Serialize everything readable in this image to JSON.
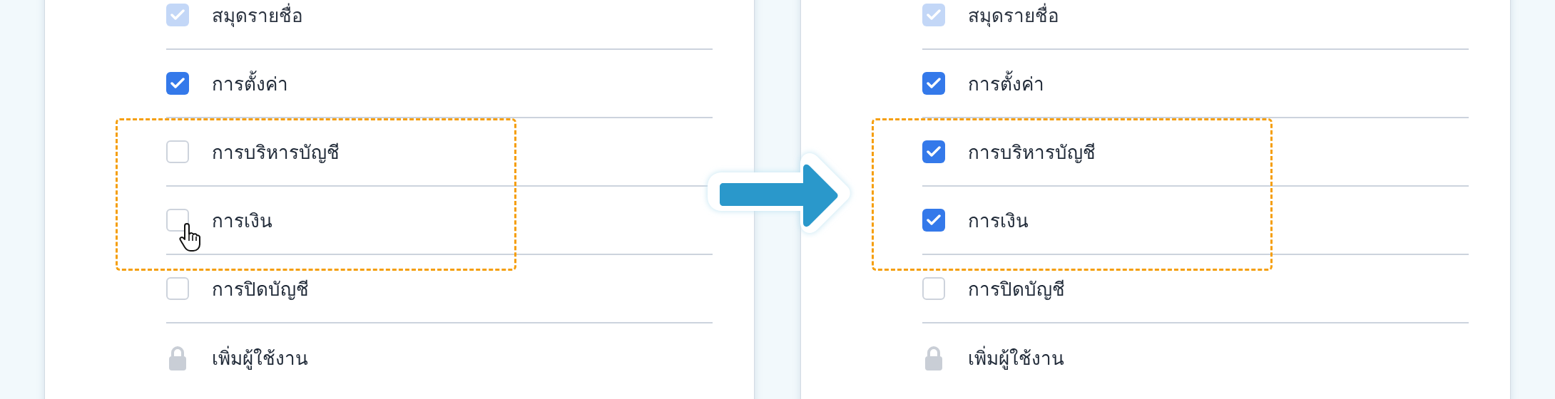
{
  "panels": [
    {
      "rows": [
        {
          "kind": "checkbox",
          "label": "สมุดรายชื่อ",
          "checked": true,
          "disabled": true,
          "highlighted": false,
          "hovered": false
        },
        {
          "kind": "checkbox",
          "label": "การตั้งค่า",
          "checked": true,
          "disabled": false,
          "highlighted": false,
          "hovered": false
        },
        {
          "kind": "checkbox",
          "label": "การบริหารบัญชี",
          "checked": false,
          "disabled": false,
          "highlighted": true,
          "hovered": false
        },
        {
          "kind": "checkbox",
          "label": "การเงิน",
          "checked": false,
          "disabled": false,
          "highlighted": true,
          "hovered": true
        },
        {
          "kind": "checkbox",
          "label": "การปิดบัญชี",
          "checked": false,
          "disabled": false,
          "highlighted": false,
          "hovered": false
        },
        {
          "kind": "locked",
          "label": "เพิ่มผู้ใช้งาน"
        }
      ]
    },
    {
      "rows": [
        {
          "kind": "checkbox",
          "label": "สมุดรายชื่อ",
          "checked": true,
          "disabled": true,
          "highlighted": false,
          "hovered": false
        },
        {
          "kind": "checkbox",
          "label": "การตั้งค่า",
          "checked": true,
          "disabled": false,
          "highlighted": false,
          "hovered": false
        },
        {
          "kind": "checkbox",
          "label": "การบริหารบัญชี",
          "checked": true,
          "disabled": false,
          "highlighted": true,
          "hovered": false
        },
        {
          "kind": "checkbox",
          "label": "การเงิน",
          "checked": true,
          "disabled": false,
          "highlighted": true,
          "hovered": false
        },
        {
          "kind": "checkbox",
          "label": "การปิดบัญชี",
          "checked": false,
          "disabled": false,
          "highlighted": false,
          "hovered": false
        },
        {
          "kind": "locked",
          "label": "เพิ่มผู้ใช้งาน"
        }
      ]
    }
  ]
}
